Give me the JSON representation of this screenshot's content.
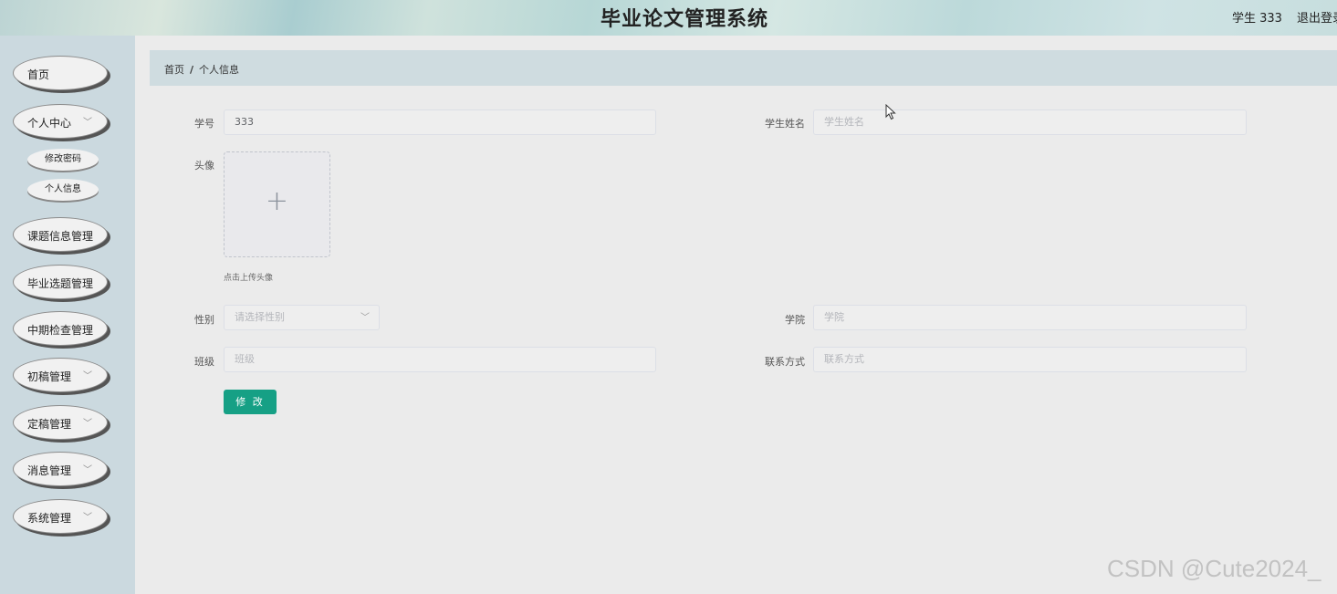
{
  "header": {
    "title": "毕业论文管理系统",
    "user": "学生 333",
    "logout": "退出登录"
  },
  "sidebar": {
    "items": [
      {
        "label": "首页"
      },
      {
        "label": "个人中心",
        "chevron": "chevron-down-icon",
        "children": [
          {
            "label": "修改密码"
          },
          {
            "label": "个人信息"
          }
        ]
      },
      {
        "label": "课题信息管理"
      },
      {
        "label": "毕业选题管理"
      },
      {
        "label": "中期检查管理"
      },
      {
        "label": "初稿管理",
        "chevron": "chevron-down-icon"
      },
      {
        "label": "定稿管理",
        "chevron": "chevron-down-icon"
      },
      {
        "label": "消息管理",
        "chevron": "chevron-down-icon"
      },
      {
        "label": "系统管理",
        "chevron": "chevron-down-icon"
      }
    ]
  },
  "breadcrumb": {
    "home": "首页",
    "separator": "/",
    "current": "个人信息"
  },
  "form": {
    "student_no": {
      "label": "学号",
      "value": "333"
    },
    "student_name": {
      "label": "学生姓名",
      "placeholder": "学生姓名"
    },
    "avatar": {
      "label": "头像",
      "hint": "点击上传头像",
      "icon": "plus-icon"
    },
    "gender": {
      "label": "性别",
      "placeholder": "请选择性别"
    },
    "college": {
      "label": "学院",
      "placeholder": "学院"
    },
    "class": {
      "label": "班级",
      "placeholder": "班级"
    },
    "contact": {
      "label": "联系方式",
      "placeholder": "联系方式"
    },
    "submit_label": "修 改"
  },
  "watermark": "CSDN @Cute2024_",
  "colors": {
    "primary_button": "#16a085",
    "sidebar_bg": "#cbd9df",
    "breadcrumb_bg": "#cfdce0",
    "page_bg": "#ebebeb"
  }
}
